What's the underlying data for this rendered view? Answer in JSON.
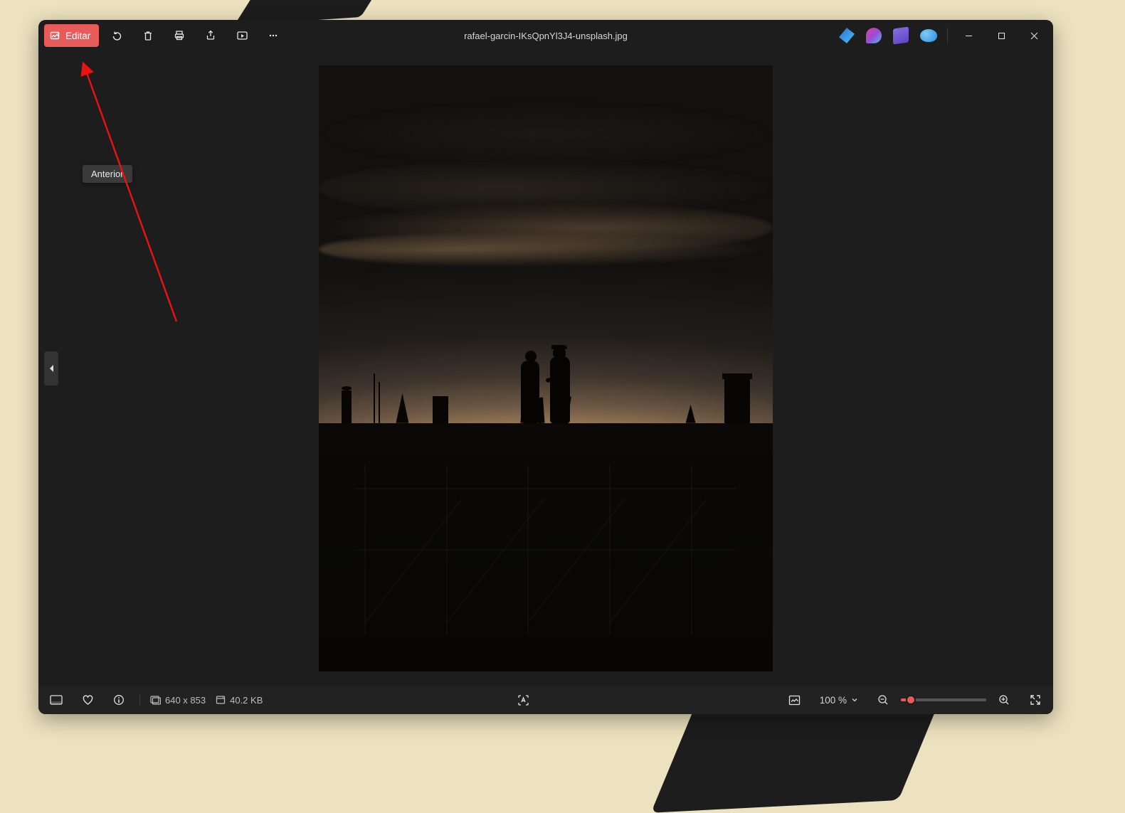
{
  "titlebar": {
    "edit_label": "Editar",
    "filename": "rafael-garcin-IKsQpnYl3J4-unsplash.jpg"
  },
  "tooltip": {
    "previous": "Anterior"
  },
  "statusbar": {
    "dimensions": "640 x 853",
    "filesize": "40.2 KB",
    "zoom_pct": "100 %"
  }
}
